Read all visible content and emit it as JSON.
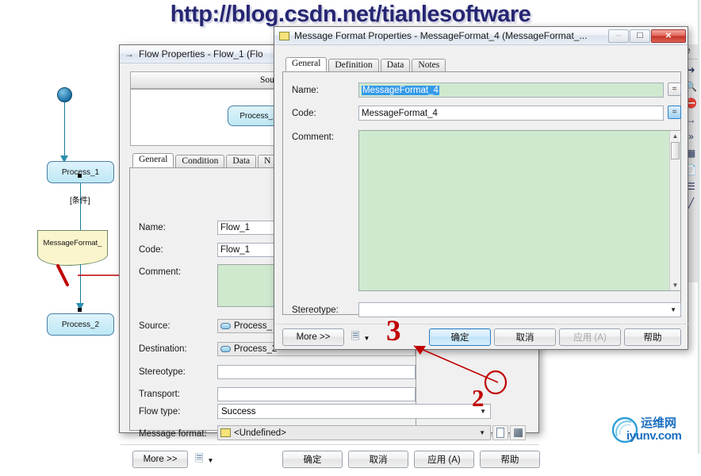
{
  "watermark": {
    "text": "http://blog.csdn.net/tianlesoftware"
  },
  "diagram": {
    "start_node": "start-node",
    "process_1": "Process_1",
    "condition_label": "[条件]",
    "message_format_note": "MessageFormat_",
    "process_2": "Process_2",
    "annotation_1": "1"
  },
  "palette": {
    "label": "le",
    "icons": [
      "pointer-icon",
      "zoom-icon",
      "delete-icon",
      "arrow-icon",
      "double-arrow-icon",
      "table-icon",
      "note-icon",
      "list-icon",
      "line-icon"
    ]
  },
  "flow_window": {
    "title": "Flow Properties - Flow_1 (Flo",
    "icon": "flow-arrow-icon",
    "source_panel_header": "Source",
    "source_node": "Process_1",
    "tabs": [
      {
        "label": "General",
        "active": true
      },
      {
        "label": "Condition",
        "active": false
      },
      {
        "label": "Data",
        "active": false
      },
      {
        "label": "N",
        "active": false
      }
    ],
    "fields": {
      "name_label": "Name:",
      "name_value": "Flow_1",
      "code_label": "Code:",
      "code_value": "Flow_1",
      "comment_label": "Comment:",
      "comment_value": "",
      "source_label": "Source:",
      "source_value": "Process_",
      "destination_label": "Destination:",
      "destination_value": "Process_2",
      "stereotype_label": "Stereotype:",
      "stereotype_value": "",
      "transport_label": "Transport:",
      "transport_value": "",
      "flow_type_label": "Flow type:",
      "flow_type_value": "Success",
      "message_format_label": "Message format:",
      "message_format_value": "<Undefined>"
    },
    "buttons": {
      "more": "More >>",
      "print_icon": "printer-icon",
      "print_caret": "chevron-down-icon",
      "ok": "确定",
      "cancel": "取消",
      "apply": "应用 (A)",
      "help": "帮助"
    },
    "annotation_2": "2"
  },
  "message_window": {
    "title": "Message Format Properties - MessageFormat_4 (MessageFormat_...",
    "icon": "note-yellow-icon",
    "window_buttons": {
      "minimize": "minimize-icon",
      "restore": "restore-icon",
      "close": "close-icon"
    },
    "tabs": [
      {
        "label": "General",
        "active": true
      },
      {
        "label": "Definition",
        "active": false
      },
      {
        "label": "Data",
        "active": false
      },
      {
        "label": "Notes",
        "active": false
      }
    ],
    "fields": {
      "name_label": "Name:",
      "name_value": "MessageFormat_4",
      "name_selected": true,
      "code_label": "Code:",
      "code_value": "MessageFormat_4",
      "comment_label": "Comment:",
      "comment_value": "",
      "stereotype_label": "Stereotype:",
      "stereotype_value": ""
    },
    "buttons": {
      "more": "More >>",
      "print_icon": "printer-icon",
      "print_caret": "chevron-down-icon",
      "ok": "确定",
      "cancel": "取消",
      "apply": "应用 (A)",
      "help": "帮助"
    },
    "annotation_3": "3"
  },
  "logo": {
    "cn": "运维网",
    "en": "iyunv.com"
  },
  "colors": {
    "accent_blue": "#2e7fc4",
    "field_green": "#cfe9cf",
    "selection_blue": "#3399e8",
    "annotation_red": "#c00000",
    "watermark_navy": "#262673",
    "node_fill": "#bde8f5"
  }
}
